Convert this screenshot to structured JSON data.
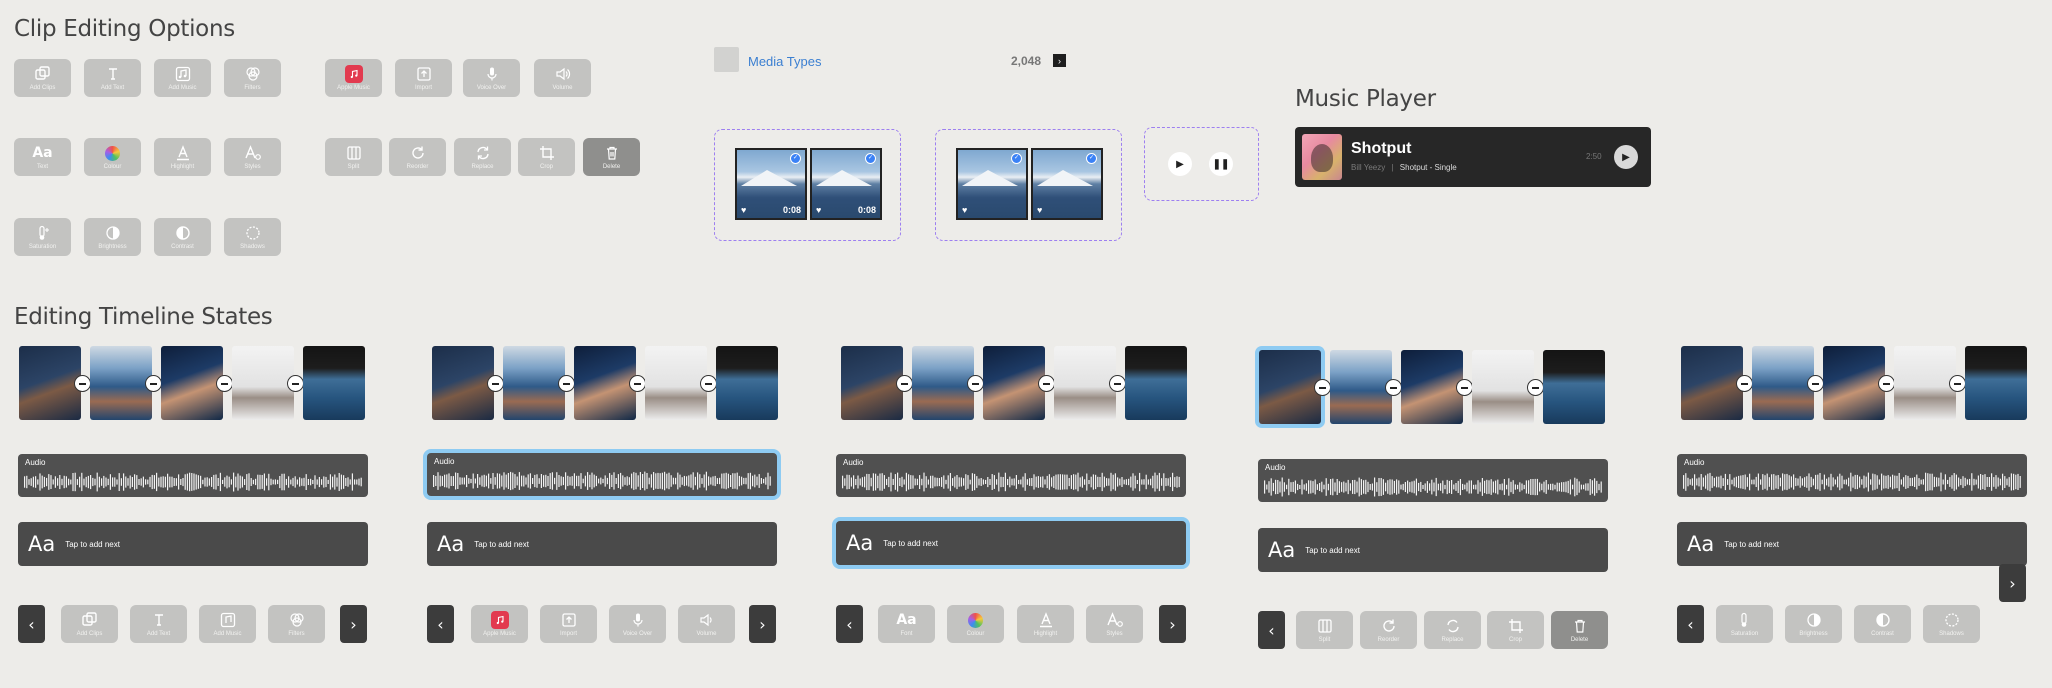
{
  "sections": {
    "clip_editing": "Clip Editing Options",
    "timeline_states": "Editing Timeline States",
    "music_player": "Music Player"
  },
  "tools": {
    "add_clips": "Add Clips",
    "add_text": "Add Text",
    "add_music": "Add Music",
    "filters": "Filters",
    "apple_music": "Apple Music",
    "import": "Import",
    "voice_over": "Voice Over",
    "volume": "Volume",
    "text": "Text",
    "colour": "Colour",
    "highlight": "Highlight",
    "styles": "Styles",
    "split": "Split",
    "reorder": "Reorder",
    "replace": "Replace",
    "crop": "Crop",
    "delete": "Delete",
    "saturation": "Saturation",
    "brightness": "Brightness",
    "contrast": "Contrast",
    "shadows": "Shadows",
    "aa": "Aa"
  },
  "media": {
    "link": "Media Types",
    "count": "2,048",
    "duration_1": "0:08",
    "duration_2": "0:08"
  },
  "player": {
    "song": "Shotput",
    "artist": "Bill Yeezy",
    "separator": "|",
    "album": "Shotput - Single",
    "time": "2:50"
  },
  "timeline": {
    "audio_label": "Audio",
    "text_prompt": "Tap to add next",
    "text_icon": "Aa",
    "font_label": "Font",
    "states": [
      {
        "audio": "Audio",
        "prompt": "Tap to add next",
        "tools": [
          "Add Clips",
          "Add Text",
          "Add Music",
          "Filters"
        ]
      },
      {
        "audio": "Audio",
        "prompt": "Tap to add next",
        "tools": [
          "Apple Music",
          "Import",
          "Voice Over",
          "Volume"
        ]
      },
      {
        "audio": "Audio",
        "prompt": "Tap to add next",
        "tools": [
          "Font",
          "Colour",
          "Highlight",
          "Styles"
        ]
      },
      {
        "audio": "Audio",
        "prompt": "Tap to add next",
        "tools": [
          "Split",
          "Reorder",
          "Replace",
          "Crop",
          "Delete"
        ]
      },
      {
        "audio": "Audio",
        "prompt": "Tap to add next",
        "tools": [
          "Saturation",
          "Brightness",
          "Contrast",
          "Shadows"
        ]
      }
    ]
  },
  "colors": {
    "accent_selection": "#8ecbf2",
    "dashed_border": "#9d7ff0",
    "link_blue": "#3b7fd1",
    "apple_music_red": "#e23a4f"
  }
}
